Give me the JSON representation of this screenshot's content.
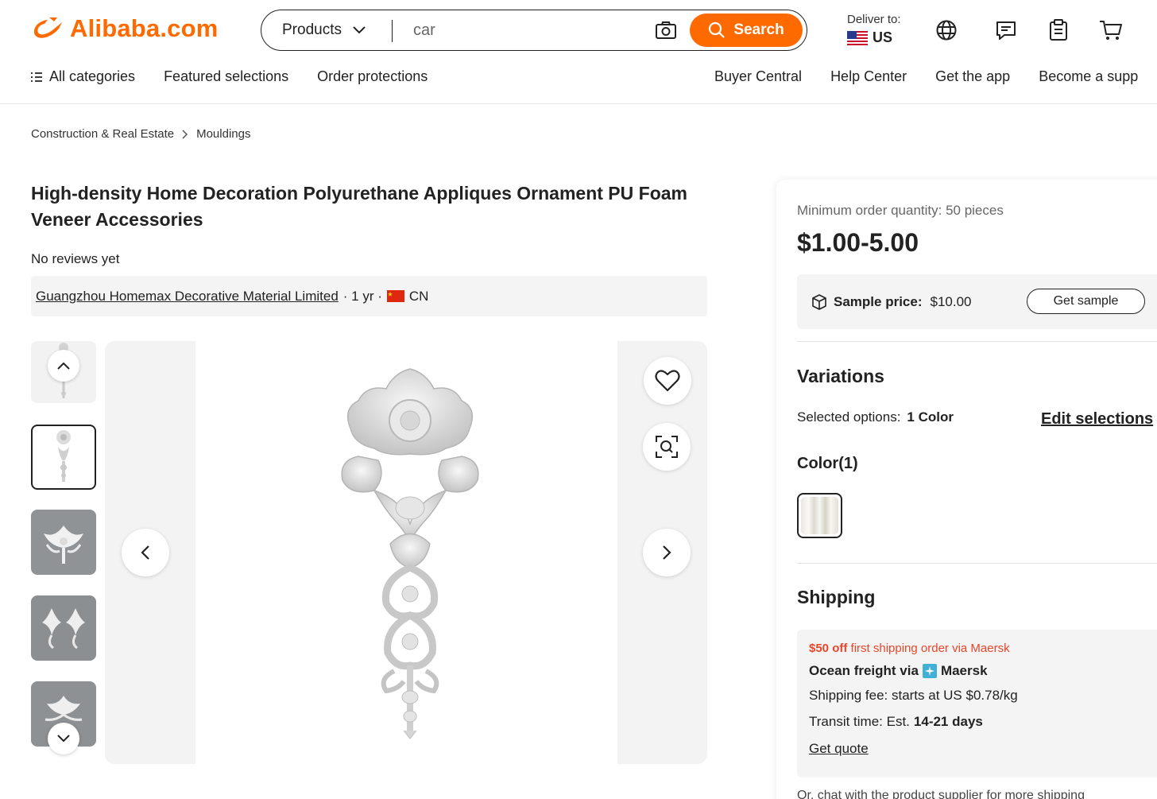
{
  "brand": {
    "name": "Alibaba.com",
    "color": "#ff6a00"
  },
  "search": {
    "category": "Products",
    "query": "car",
    "button_label": "Search"
  },
  "delivery": {
    "label": "Deliver to:",
    "country": "US"
  },
  "header_icons": [
    "globe-icon",
    "messages-icon",
    "orders-icon",
    "cart-icon"
  ],
  "subnav": {
    "left": [
      "All categories",
      "Featured selections",
      "Order protections"
    ],
    "right": [
      "Buyer Central",
      "Help Center",
      "Get the app",
      "Become a supp"
    ]
  },
  "breadcrumb": [
    "Construction & Real Estate",
    "Mouldings"
  ],
  "product": {
    "title": "High-density Home Decoration Polyurethane Appliques Ornament PU Foam Veneer Accessories",
    "reviews": "No reviews yet",
    "supplier": "Guangzhou Homemax Decorative Material Limited",
    "supplier_years": "· 1 yr ·",
    "supplier_country": "CN"
  },
  "gallery": {
    "thumbnail_count": 5,
    "selected_index": 1
  },
  "pricing": {
    "moq": "Minimum order quantity: 50 pieces",
    "price_range": "$1.00-5.00",
    "sample_label": "Sample price:",
    "sample_price": "$10.00",
    "get_sample": "Get sample"
  },
  "variations": {
    "title": "Variations",
    "selected_label": "Selected options:",
    "selected_value": "1 Color",
    "edit_label": "Edit selections",
    "color_label": "Color(1)"
  },
  "shipping": {
    "title": "Shipping",
    "promo_bold": "$50 off",
    "promo_rest": "first shipping order via Maersk",
    "method_prefix": "Ocean freight via",
    "carrier": "Maersk",
    "fee": "Shipping fee: starts at US $0.78/kg",
    "transit_prefix": "Transit time: Est.",
    "transit_days": "14-21 days",
    "quote": "Get quote",
    "chat_note": "Or, chat with the product supplier for more shipping"
  },
  "colors": {
    "promo_red": "#e8462b",
    "maersk_blue": "#42b0d5"
  }
}
